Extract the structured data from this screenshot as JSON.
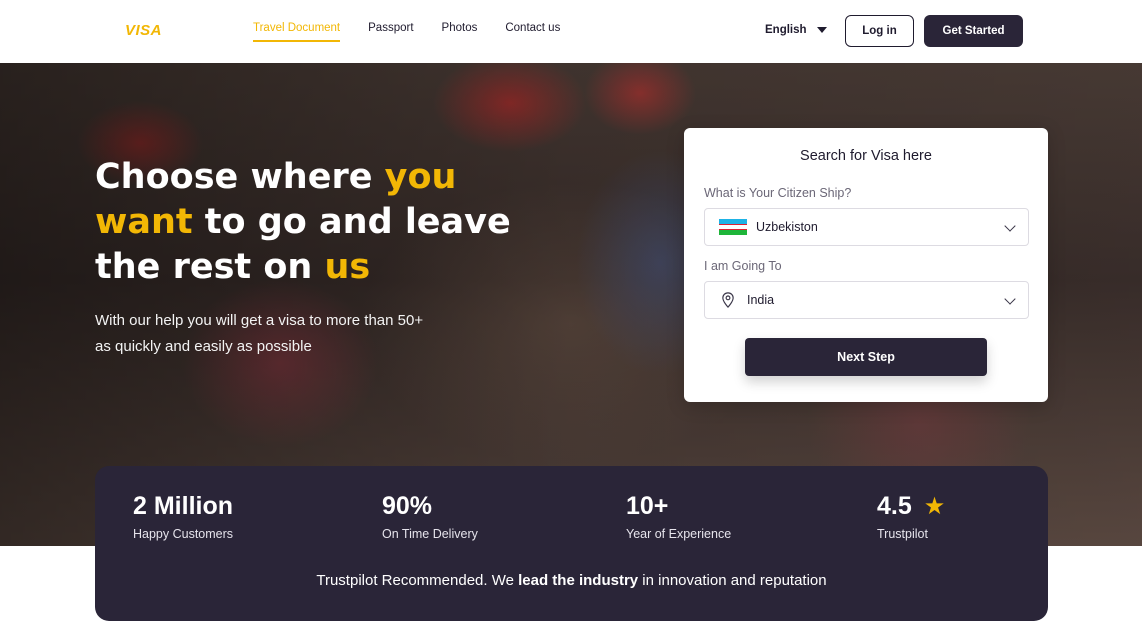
{
  "nav": {
    "logo": "VISA",
    "links": [
      "Travel Document",
      "Passport",
      "Photos",
      "Contact us"
    ],
    "active_link": "Travel Document",
    "language": "English",
    "login_label": "Log in",
    "get_started_label": "Get Started"
  },
  "hero": {
    "title_part1": "Choose where ",
    "title_highlight1": "you want",
    "title_part2": " to go and leave the rest on ",
    "title_highlight2": "us",
    "subtitle": "With our help you will get a visa to more than 50+ as quickly and easily as possible"
  },
  "search": {
    "title": "Search for Visa here",
    "citizenship_label": "What is Your Citizen Ship?",
    "citizenship_value": "Uzbekiston",
    "destination_label": "I am Going To",
    "destination_value": "India",
    "next_label": "Next Step"
  },
  "stats": {
    "items": [
      {
        "value": "2 Million",
        "label": "Happy Customers"
      },
      {
        "value": "90%",
        "label": "On Time Delivery"
      },
      {
        "value": "10+",
        "label": "Year of Experience"
      },
      {
        "value": "4.5",
        "label": "Trustpilot"
      }
    ],
    "footer_part1": "Trustpilot Recommended. We ",
    "footer_bold": "lead the industry",
    "footer_part2": " in innovation and reputation"
  },
  "colors": {
    "accent": "#f2b705",
    "dark": "#2a2538"
  }
}
